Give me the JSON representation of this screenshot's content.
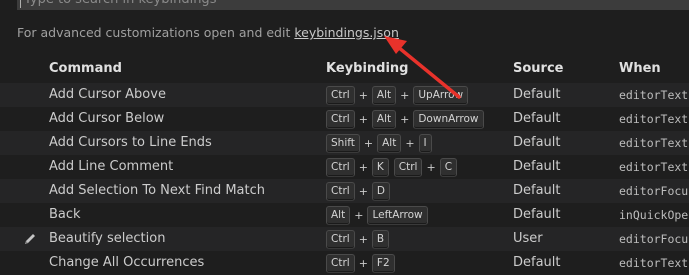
{
  "search": {
    "placeholder": "Type to search in keybindings"
  },
  "hint": {
    "text": "For advanced customizations open and edit ",
    "link": "keybindings.json"
  },
  "columns": {
    "command": "Command",
    "keybinding": "Keybinding",
    "source": "Source",
    "when": "When"
  },
  "rows": [
    {
      "command": "Add Cursor Above",
      "keys": [
        [
          "Ctrl",
          "Alt",
          "UpArrow"
        ]
      ],
      "source": "Default",
      "when": "editorTextF"
    },
    {
      "command": "Add Cursor Below",
      "keys": [
        [
          "Ctrl",
          "Alt",
          "DownArrow"
        ]
      ],
      "source": "Default",
      "when": "editorTextF"
    },
    {
      "command": "Add Cursors to Line Ends",
      "keys": [
        [
          "Shift",
          "Alt",
          "I"
        ]
      ],
      "source": "Default",
      "when": "editorTextF"
    },
    {
      "command": "Add Line Comment",
      "keys": [
        [
          "Ctrl",
          "K"
        ],
        [
          "Ctrl",
          "C"
        ]
      ],
      "source": "Default",
      "when": "editorTextF"
    },
    {
      "command": "Add Selection To Next Find Match",
      "keys": [
        [
          "Ctrl",
          "D"
        ]
      ],
      "source": "Default",
      "when": "editorFocus"
    },
    {
      "command": "Back",
      "keys": [
        [
          "Alt",
          "LeftArrow"
        ]
      ],
      "source": "Default",
      "when": "inQuickOpen"
    },
    {
      "command": "Beautify selection",
      "keys": [
        [
          "Ctrl",
          "B"
        ]
      ],
      "source": "User",
      "when": "editorFocus",
      "edit_icon": "pencil-icon"
    },
    {
      "command": "Change All Occurrences",
      "keys": [
        [
          "Ctrl",
          "F2"
        ]
      ],
      "source": "Default",
      "when": "editorTextF"
    }
  ],
  "annotation": {
    "arrow_color": "#e8322b"
  }
}
